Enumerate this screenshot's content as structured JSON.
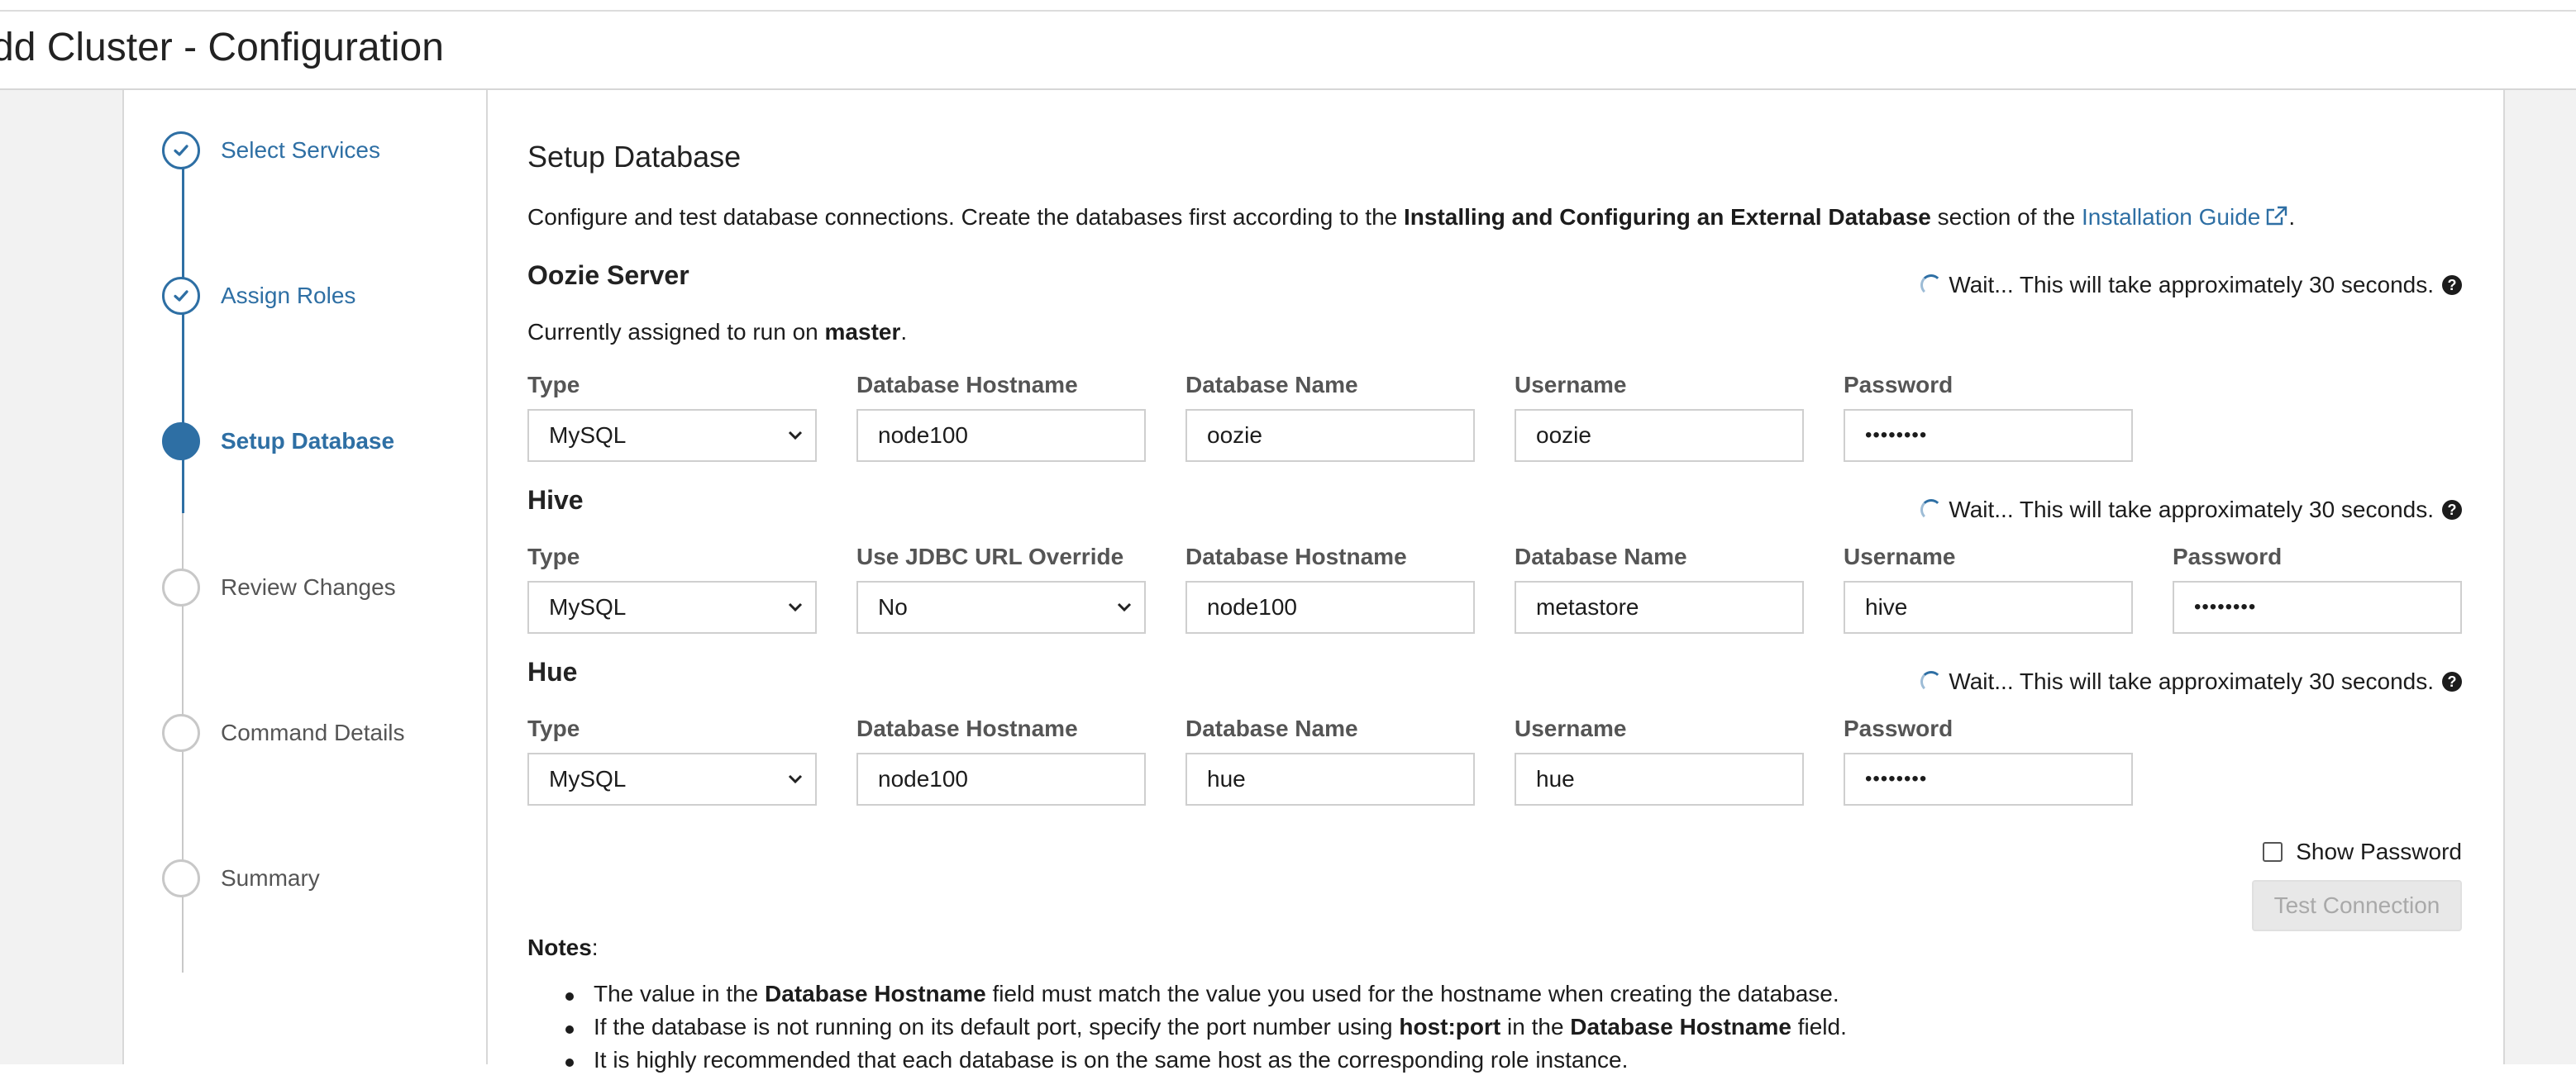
{
  "page": {
    "title": "dd Cluster - Configuration"
  },
  "wizard": {
    "steps": [
      {
        "label": "Select Services",
        "state": "done"
      },
      {
        "label": "Assign Roles",
        "state": "done"
      },
      {
        "label": "Setup Database",
        "state": "active"
      },
      {
        "label": "Review Changes",
        "state": "pending"
      },
      {
        "label": "Command Details",
        "state": "pending"
      },
      {
        "label": "Summary",
        "state": "pending"
      }
    ]
  },
  "main": {
    "title": "Setup Database",
    "intro": {
      "text1": "Configure and test database connections. Create the databases first according to the ",
      "bold": "Installing and Configuring an External Database",
      "text2": " section of the ",
      "link": "Installation Guide",
      "end": "."
    },
    "wait_text": "Wait... This will take approximately 30 seconds.",
    "oozie": {
      "title": "Oozie Server",
      "assigned_prefix": "Currently assigned to run on ",
      "assigned_host": "master",
      "assigned_suffix": ".",
      "labels": {
        "type": "Type",
        "host": "Database Hostname",
        "name": "Database Name",
        "user": "Username",
        "password": "Password"
      },
      "values": {
        "type": "MySQL",
        "host": "node100",
        "name": "oozie",
        "user": "oozie",
        "password": "••••••••"
      }
    },
    "hive": {
      "title": "Hive",
      "labels": {
        "type": "Type",
        "jdbc": "Use JDBC URL Override",
        "host": "Database Hostname",
        "name": "Database Name",
        "user": "Username",
        "password": "Password"
      },
      "values": {
        "type": "MySQL",
        "jdbc": "No",
        "host": "node100",
        "name": "metastore",
        "user": "hive",
        "password": "••••••••"
      }
    },
    "hue": {
      "title": "Hue",
      "labels": {
        "type": "Type",
        "host": "Database Hostname",
        "name": "Database Name",
        "user": "Username",
        "password": "Password"
      },
      "values": {
        "type": "MySQL",
        "host": "node100",
        "name": "hue",
        "user": "hue",
        "password": "••••••••"
      }
    },
    "show_password_label": "Show Password",
    "test_connection_label": "Test Connection",
    "notes": {
      "heading": "Notes",
      "colon": ":",
      "items": [
        {
          "pre": "The value in the ",
          "bold": "Database Hostname",
          "post": " field must match the value you used for the hostname when creating the database."
        },
        {
          "pre": "If the database is not running on its default port, specify the port number using ",
          "bold": "host:port",
          "mid": " in the ",
          "bold2": "Database Hostname",
          "post": " field."
        },
        {
          "pre": "It is highly recommended that each database is on the same host as the corresponding role instance."
        }
      ]
    }
  },
  "colors": {
    "accent": "#2e6fa4",
    "pending": "#c8c8c8",
    "sidebar_bg": "#f2f2f2"
  },
  "icons": {
    "done": "check-icon",
    "help": "question-circle-icon",
    "external": "external-link-icon",
    "select": "chevron-down-icon",
    "spinner": "spinner-icon"
  }
}
